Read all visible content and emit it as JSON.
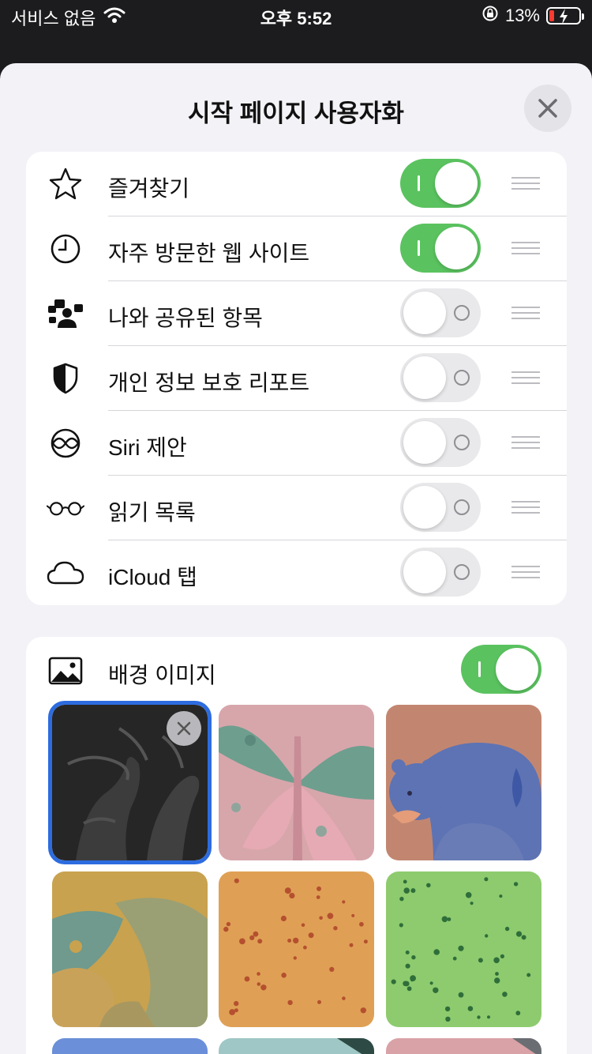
{
  "status_bar": {
    "carrier": "서비스 없음",
    "time": "오후 5:52",
    "battery": "13%"
  },
  "sheet": {
    "title": "시작 페이지 사용자화"
  },
  "sections": [
    {
      "label": "즐겨찾기",
      "enabled": true,
      "icon": "star-icon"
    },
    {
      "label": "자주 방문한 웹 사이트",
      "enabled": true,
      "icon": "clock-icon"
    },
    {
      "label": "나와 공유된 항목",
      "enabled": false,
      "icon": "shared-people-icon"
    },
    {
      "label": "개인 정보 보호 리포트",
      "enabled": false,
      "icon": "shield-icon"
    },
    {
      "label": "Siri 제안",
      "enabled": false,
      "icon": "siri-icon"
    },
    {
      "label": "읽기 목록",
      "enabled": false,
      "icon": "glasses-icon"
    },
    {
      "label": "iCloud 탭",
      "enabled": false,
      "icon": "cloud-icon"
    }
  ],
  "background": {
    "label": "배경 이미지",
    "enabled": true,
    "images": [
      {
        "name": "hands-dark",
        "selected": true
      },
      {
        "name": "butterfly-pink",
        "selected": false
      },
      {
        "name": "bear-blue",
        "selected": false
      },
      {
        "name": "parrot-mustard",
        "selected": false
      },
      {
        "name": "orange-pattern",
        "selected": false
      },
      {
        "name": "green-pattern",
        "selected": false
      }
    ]
  },
  "colors": {
    "toggle_on": "#5ac35f",
    "toggle_off": "#e9e9eb",
    "selected_outline": "#2d6cdf"
  }
}
